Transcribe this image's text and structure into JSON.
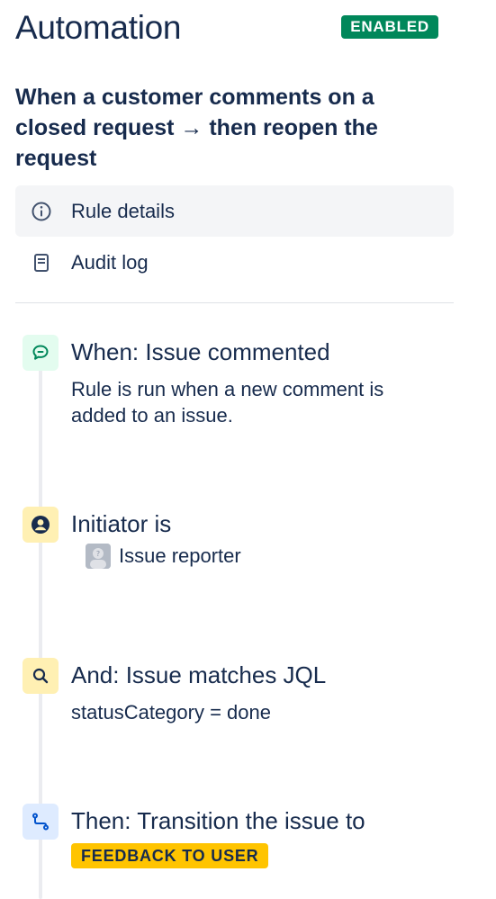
{
  "header": {
    "title": "Automation",
    "status": "ENABLED"
  },
  "rule": {
    "name": "When a customer comments on a closed request → then reopen the request"
  },
  "nav": {
    "items": [
      {
        "label": "Rule details",
        "icon": "info-icon",
        "active": true
      },
      {
        "label": "Audit log",
        "icon": "document-icon",
        "active": false
      }
    ]
  },
  "steps": [
    {
      "title": "When: Issue commented",
      "description": "Rule is run when a new comment is added to an issue.",
      "icon": "comment-icon",
      "icon_color": "#00875a"
    },
    {
      "title": "Initiator is",
      "value": "Issue reporter",
      "icon": "user-icon",
      "icon_color": "#172b4d"
    },
    {
      "title": "And: Issue matches JQL",
      "description": "statusCategory = done",
      "icon": "search-icon",
      "icon_color": "#172b4d"
    },
    {
      "title": "Then: Transition the issue to",
      "value": "FEEDBACK TO USER",
      "icon": "transition-icon",
      "icon_color": "#0052cc"
    }
  ],
  "colors": {
    "enabled_badge": "#00875a",
    "status_lozenge": "#ffc400",
    "trigger_icon_bg": "#e3fcef",
    "condition_icon_bg": "#fff0b3",
    "action_icon_bg": "#deebff"
  }
}
